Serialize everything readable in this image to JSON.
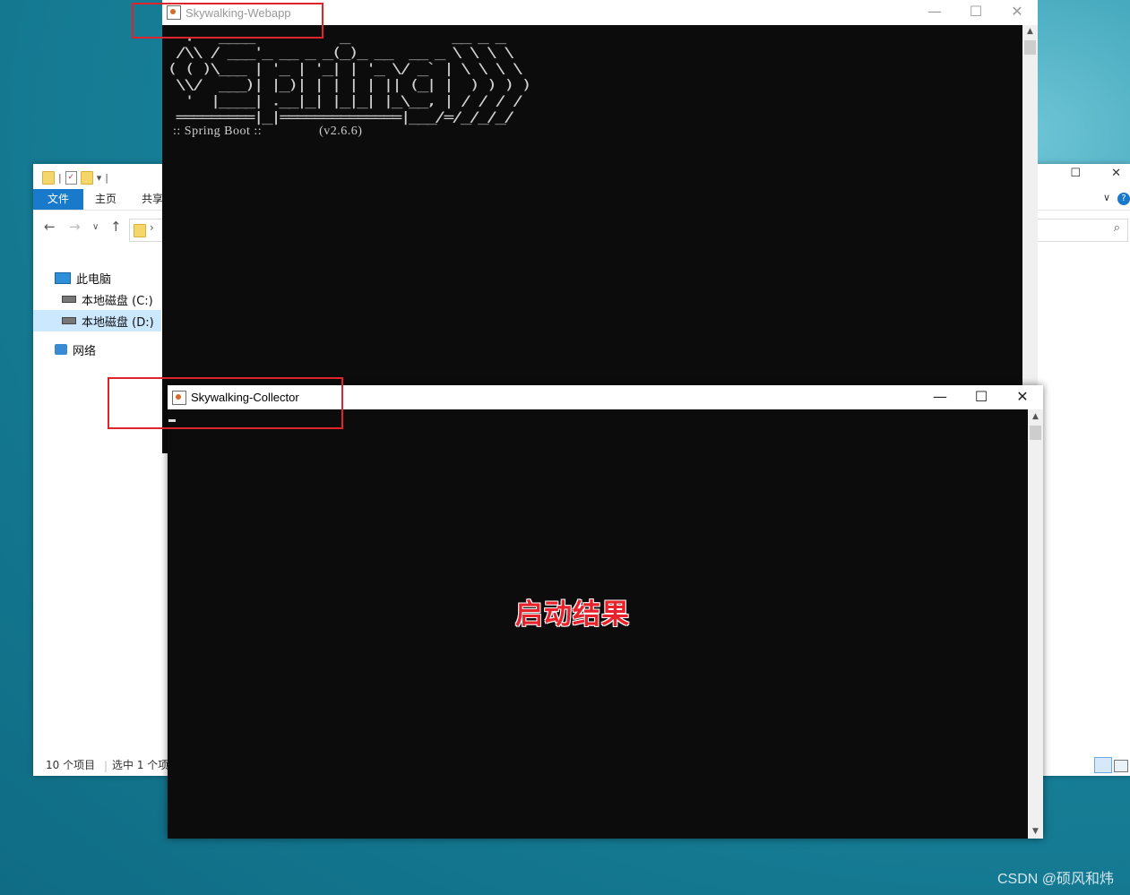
{
  "explorer": {
    "ribbon_tabs": [
      "文件",
      "主页",
      "共享"
    ],
    "tree": {
      "this_pc": "此电脑",
      "drive_c": "本地磁盘 (C:)",
      "drive_d": "本地磁盘 (D:)",
      "network": "网络"
    },
    "status": {
      "item_count": "10 个项目",
      "selected": "选中 1 个项"
    }
  },
  "webapp_window": {
    "title": "Skywalking-Webapp",
    "banner": "  .   ____          _            __ _ _\n /\\\\ / ___'_ __ _ _(_)_ __  __ _ \\ \\ \\ \\\n( ( )\\___ | '_ | '_| | '_ \\/ _` | \\ \\ \\ \\\n \\\\/  ___)| |_)| | | | | || (_| |  ) ) ) )\n  '  |____| .__|_| |_|_| |_\\__, | / / / /\n =========|_|==============|___/=/_/_/_/",
    "boot_line": " :: Spring Boot ::                (v2.6.6)"
  },
  "collector_window": {
    "title": "Skywalking-Collector"
  },
  "annotation": {
    "result_label": "启动结果",
    "highlight_color": "#e0242b"
  },
  "watermark": "CSDN @硕风和炜",
  "controls": {
    "minimize": "—",
    "maximize": "☐",
    "close": "✕"
  }
}
